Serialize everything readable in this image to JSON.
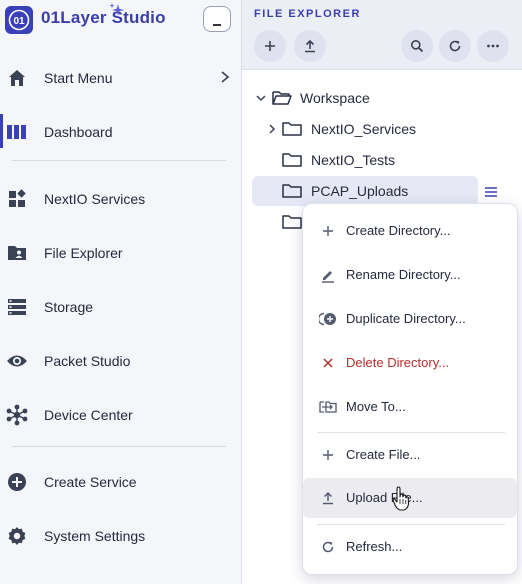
{
  "sidebar": {
    "brand_logo_text": "01",
    "brand_name": "01Layer Studio",
    "items": [
      {
        "label": "Start Menu",
        "icon": "home-icon"
      },
      {
        "label": "Dashboard",
        "icon": "dashboard-icon"
      },
      {
        "label": "NextIO Services",
        "icon": "services-icon"
      },
      {
        "label": "File Explorer",
        "icon": "folder-user-icon"
      },
      {
        "label": "Storage",
        "icon": "storage-icon"
      },
      {
        "label": "Packet Studio",
        "icon": "eye-icon"
      },
      {
        "label": "Device Center",
        "icon": "device-hub-icon"
      },
      {
        "label": "Create Service",
        "icon": "add-circle-icon"
      },
      {
        "label": "System Settings",
        "icon": "gear-icon"
      }
    ]
  },
  "explorer": {
    "title": "FILE EXPLORER",
    "tree": [
      {
        "label": "Workspace",
        "expanded": true
      },
      {
        "label": "NextIO_Services",
        "collapsed": true
      },
      {
        "label": "NextIO_Tests"
      },
      {
        "label": "PCAP_Uploads",
        "selected": true
      },
      {
        "label": ""
      }
    ]
  },
  "context_menu": {
    "items": [
      {
        "label": "Create Directory...",
        "icon": "plus-icon"
      },
      {
        "label": "Rename Directory...",
        "icon": "rename-icon"
      },
      {
        "label": "Duplicate Directory...",
        "icon": "duplicate-icon"
      },
      {
        "label": "Delete Directory...",
        "icon": "delete-icon"
      },
      {
        "label": "Move To...",
        "icon": "move-icon"
      },
      {
        "label": "Create File...",
        "icon": "plus-icon"
      },
      {
        "label": "Upload File...",
        "icon": "upload-icon"
      },
      {
        "label": "Refresh...",
        "icon": "refresh-icon"
      }
    ]
  },
  "colors": {
    "accent": "#3a41b8",
    "danger": "#b3312e",
    "sidebar_bg": "#f5f6fa"
  }
}
